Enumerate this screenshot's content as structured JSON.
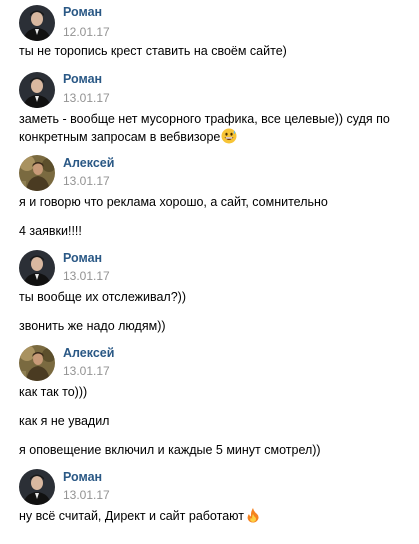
{
  "messages": [
    {
      "author": "Роман",
      "date": "12.01.17",
      "avatar": "roman-avatar",
      "lines": [
        "ты не торопись крест ставить на своём сайте)"
      ]
    },
    {
      "author": "Роман",
      "date": "13.01.17",
      "avatar": "roman-avatar",
      "lines": [
        "заметь - вообще нет мусорного трафика, все целевые)) судя по конкретным запросам в вебвизоре"
      ],
      "emoji": "grinning-sweat-emoji"
    },
    {
      "author": "Алексей",
      "date": "13.01.17",
      "avatar": "aleksey-avatar",
      "lines": [
        "я и говорю что реклама хорошо, а сайт, сомнительно",
        "4 заявки!!!!"
      ]
    },
    {
      "author": "Роман",
      "date": "13.01.17",
      "avatar": "roman-avatar",
      "lines": [
        "ты вообще их отслеживал?))",
        "звонить же надо людям))"
      ]
    },
    {
      "author": "Алексей",
      "date": "13.01.17",
      "avatar": "aleksey-avatar",
      "lines": [
        "как так то)))",
        "как я не увадил",
        "я оповещение включил и каждые 5 минут смотрел))"
      ]
    },
    {
      "author": "Роман",
      "date": "13.01.17",
      "avatar": "roman-avatar",
      "lines": [
        "ну всё считай, Директ и сайт работают"
      ],
      "emoji": "fire-emoji"
    }
  ],
  "colors": {
    "author": "#2a5885",
    "date": "#939393",
    "text": "#000000",
    "background": "#ffffff"
  }
}
